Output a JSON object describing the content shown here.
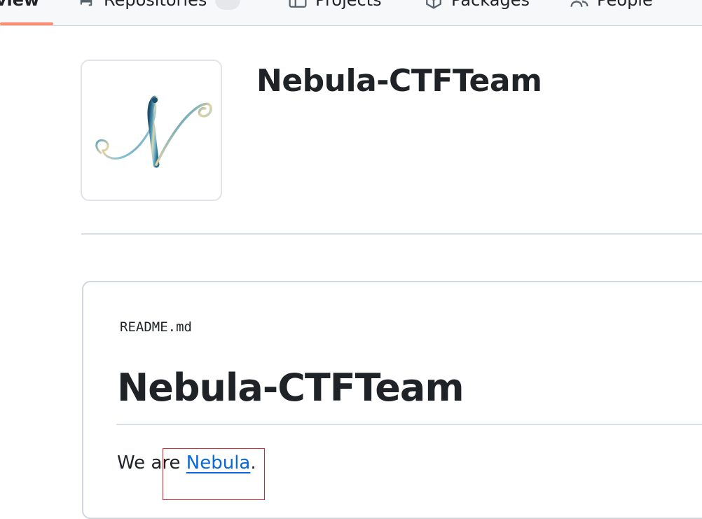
{
  "nav": {
    "tabs": [
      {
        "label": "rview",
        "icon": "book-icon"
      },
      {
        "label": "Repositories",
        "icon": "repo-icon"
      },
      {
        "label": "Projects",
        "icon": "table-icon"
      },
      {
        "label": "Packages",
        "icon": "package-icon"
      },
      {
        "label": "People",
        "icon": "people-icon"
      }
    ]
  },
  "org": {
    "name": "Nebula-CTFTeam",
    "logo_letter": "N"
  },
  "readme": {
    "filename": "README.md",
    "heading": "Nebula-CTFTeam",
    "text_before": "We are ",
    "link_text": "Nebula",
    "text_after": "."
  },
  "colors": {
    "accent_underline": "#fd8c73",
    "link": "#0969da",
    "border": "#d0d7de"
  }
}
